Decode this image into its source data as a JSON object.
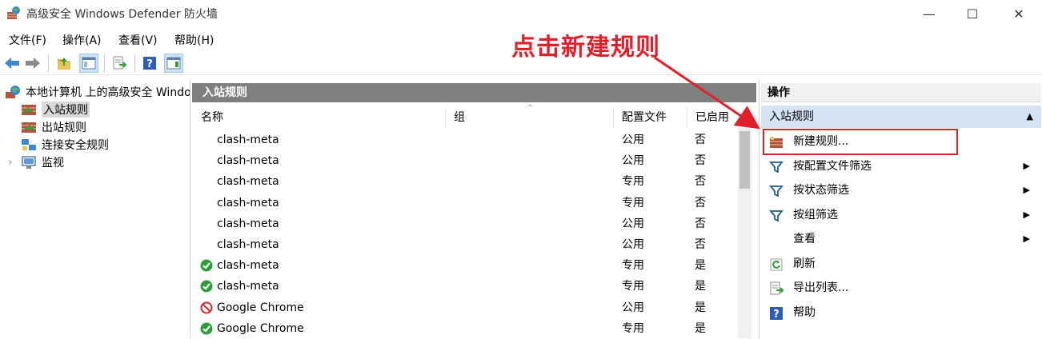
{
  "window": {
    "title": "高级安全 Windows Defender 防火墙",
    "minimize": "—",
    "maximize": "☐",
    "close": "✕"
  },
  "menu": [
    "文件(F)",
    "操作(A)",
    "查看(V)",
    "帮助(H)"
  ],
  "tree": {
    "root": "本地计算机 上的高级安全 Windows Defender 防火墙",
    "items": [
      {
        "label": "入站规则",
        "selected": true
      },
      {
        "label": "出站规则",
        "selected": false
      },
      {
        "label": "连接安全规则",
        "selected": false
      },
      {
        "label": "监视",
        "selected": false,
        "expander": "›"
      }
    ]
  },
  "center": {
    "title": "入站规则",
    "columns": {
      "name": "名称",
      "group": "组",
      "profile": "配置文件",
      "enabled": "已启用",
      "sort_indicator": "^"
    },
    "rows": [
      {
        "name": "clash-meta",
        "profile": "公用",
        "enabled": "否",
        "icon": "none"
      },
      {
        "name": "clash-meta",
        "profile": "公用",
        "enabled": "否",
        "icon": "none"
      },
      {
        "name": "clash-meta",
        "profile": "专用",
        "enabled": "否",
        "icon": "none"
      },
      {
        "name": "clash-meta",
        "profile": "专用",
        "enabled": "否",
        "icon": "none"
      },
      {
        "name": "clash-meta",
        "profile": "公用",
        "enabled": "否",
        "icon": "none"
      },
      {
        "name": "clash-meta",
        "profile": "公用",
        "enabled": "否",
        "icon": "none"
      },
      {
        "name": "clash-meta",
        "profile": "专用",
        "enabled": "是",
        "icon": "allow"
      },
      {
        "name": "clash-meta",
        "profile": "专用",
        "enabled": "是",
        "icon": "allow"
      },
      {
        "name": "Google Chrome",
        "profile": "公用",
        "enabled": "是",
        "icon": "block"
      },
      {
        "name": "Google Chrome",
        "profile": "专用",
        "enabled": "是",
        "icon": "allow"
      }
    ]
  },
  "actions": {
    "header": "操作",
    "section": "入站规则",
    "section_caret": "▲",
    "items": [
      {
        "label": "新建规则...",
        "icon": "new-rule-icon",
        "submenu": ""
      },
      {
        "label": "按配置文件筛选",
        "icon": "filter-icon",
        "submenu": "▶"
      },
      {
        "label": "按状态筛选",
        "icon": "filter-icon",
        "submenu": "▶"
      },
      {
        "label": "按组筛选",
        "icon": "filter-icon",
        "submenu": "▶"
      },
      {
        "label": "查看",
        "icon": "none",
        "submenu": "▶"
      },
      {
        "label": "刷新",
        "icon": "refresh-icon",
        "submenu": ""
      },
      {
        "label": "导出列表...",
        "icon": "export-icon",
        "submenu": ""
      },
      {
        "label": "帮助",
        "icon": "help-icon",
        "submenu": ""
      }
    ]
  },
  "annotation": {
    "text": "点击新建规则",
    "color": "#e0202a"
  }
}
